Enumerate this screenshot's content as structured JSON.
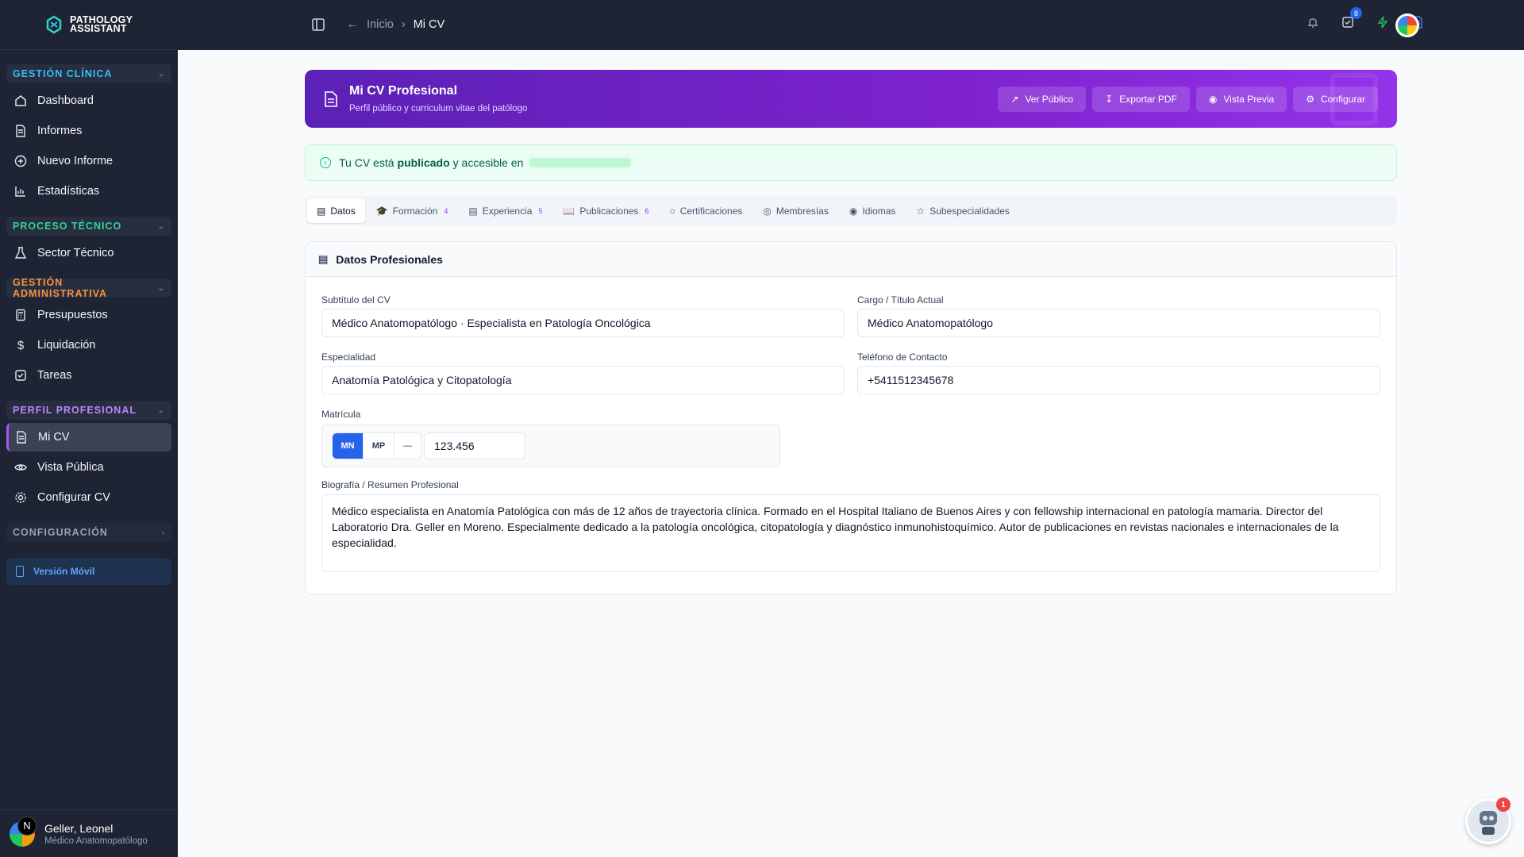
{
  "brand": {
    "line1": "PATHOLOGY",
    "line2": "ASSISTANT"
  },
  "sidebar": {
    "sections": [
      {
        "label": "GESTIÓN CLÍNICA",
        "color": "#38bdf8"
      },
      {
        "label": "PROCESO TÉCNICO",
        "color": "#34d399"
      },
      {
        "label": "GESTIÓN ADMINISTRATIVA",
        "color": "#fb923c"
      },
      {
        "label": "PERFIL PROFESIONAL",
        "color": "#c084fc"
      },
      {
        "label": "CONFIGURACIÓN",
        "color": "#94a3b8"
      }
    ],
    "items": {
      "dashboard": "Dashboard",
      "informes": "Informes",
      "nuevo_informe": "Nuevo Informe",
      "estadisticas": "Estadísticas",
      "sector_tecnico": "Sector Técnico",
      "presupuestos": "Presupuestos",
      "liquidacion": "Liquidación",
      "tareas": "Tareas",
      "mi_cv": "Mi CV",
      "vista_publica": "Vista Pública",
      "configurar_cv": "Configurar CV"
    },
    "mobile": "Versión Móvil",
    "user": {
      "initial": "N",
      "name": "Geller, Leonel",
      "role": "Médico Anatomopatólogo"
    }
  },
  "topbar": {
    "crumb_home": "Inicio",
    "crumb_sep": "›",
    "crumb_current": "Mi CV",
    "tasks_badge": "8"
  },
  "hero": {
    "title": "Mi CV Profesional",
    "subtitle": "Perfil público y curriculum vitae del patólogo",
    "buttons": [
      "Ver Público",
      "Exportar PDF",
      "Vista Previa",
      "Configurar"
    ]
  },
  "notice": {
    "pre": "Tu CV está",
    "bold": "publicado",
    "post": "y accesible en"
  },
  "tabs": [
    {
      "label": "Datos",
      "count": ""
    },
    {
      "label": "Formación",
      "count": "4"
    },
    {
      "label": "Experiencia",
      "count": "5"
    },
    {
      "label": "Publicaciones",
      "count": "6"
    },
    {
      "label": "Certificaciones",
      "count": ""
    },
    {
      "label": "Membresías",
      "count": ""
    },
    {
      "label": "Idiomas",
      "count": ""
    },
    {
      "label": "Subespecialidades",
      "count": ""
    }
  ],
  "form": {
    "title": "Datos Profesionales",
    "subtitulo_label": "Subtítulo del CV",
    "subtitulo_value": "Médico Anatomopatólogo · Especialista en Patología Oncológica",
    "cargo_label": "Cargo / Título Actual",
    "cargo_value": "Médico Anatomopatólogo",
    "especialidad_label": "Especialidad",
    "especialidad_value": "Anatomía Patológica y Citopatología",
    "telefono_label": "Teléfono de Contacto",
    "telefono_value": "+5411512345678",
    "matricula_label": "Matrícula",
    "matricula_options": [
      "MN",
      "MP",
      "—"
    ],
    "matricula_value": "123.456",
    "bio_label": "Biografía / Resumen Profesional",
    "bio_value": "Médico especialista en Anatomía Patológica con más de 12 años de trayectoria clínica. Formado en el Hospital Italiano de Buenos Aires y con fellowship internacional en patología mamaria. Director del Laboratorio Dra. Geller en Moreno. Especialmente dedicado a la patología oncológica, citopatología y diagnóstico inmunohistoquímico. Autor de publicaciones en revistas nacionales e internacionales de la especialidad."
  },
  "assistant": {
    "badge": "1"
  }
}
